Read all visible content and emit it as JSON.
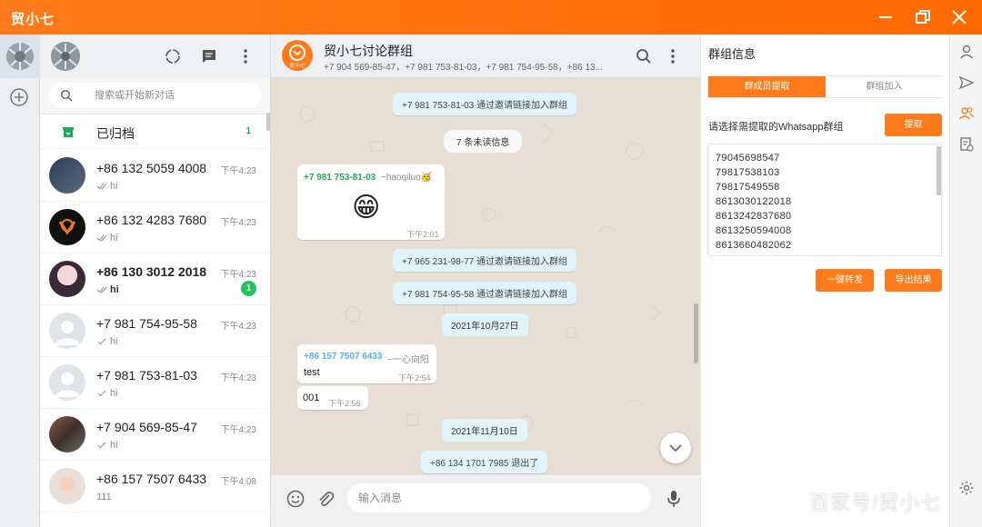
{
  "app": {
    "title": "贸小七"
  },
  "chat_list": {
    "search_placeholder": "搜索或开始新对话",
    "archived": {
      "label": "已归档",
      "count": "1"
    },
    "items": [
      {
        "name": "+86 132 5059 4008",
        "time": "下午4:23",
        "preview": "hi",
        "unread": ""
      },
      {
        "name": "+86 132 4283 7680",
        "time": "下午4:23",
        "preview": "hi",
        "unread": ""
      },
      {
        "name": "+86 130 3012 2018",
        "time": "下午4:23",
        "preview": "hi",
        "unread": "1"
      },
      {
        "name": "+7 981 754-95-58",
        "time": "下午4:23",
        "preview": "hi",
        "unread": ""
      },
      {
        "name": "+7 981 753-81-03",
        "time": "下午4:23",
        "preview": "hi",
        "unread": ""
      },
      {
        "name": "+7 904 569-85-47",
        "time": "下午4:23",
        "preview": "hi",
        "unread": ""
      },
      {
        "name": "+86 157 7507 6433",
        "time": "下午4:08",
        "preview": "111",
        "unread": ""
      }
    ]
  },
  "chat": {
    "logo_text": "贸小七",
    "title": "贸小七讨论群组",
    "members": "+7 904 569-85-47，+7 981 753-81-03，+7 981 754-95-58，+86 13...",
    "messages": {
      "sys_joined_1": "+7 981 753-81-03 通过邀请链接加入群组",
      "unread_marker": "7 条未读信息",
      "bubble1_sender": "+7 981 753-81-03",
      "bubble1_alias": "~haoqiluo🥳",
      "bubble1_emoji": "😁",
      "bubble1_time": "下午2:01",
      "sys_joined_2": "+7 965 231-98-77 通过邀请链接加入群组",
      "sys_joined_3": "+7 981 754-95-58 通过邀请链接加入群组",
      "date_1": "2021年10月27日",
      "bubble2_sender": "+86 157 7507 6433",
      "bubble2_alias": "~一心向阳",
      "bubble2_text": "test",
      "bubble2_time": "下午2:54",
      "bubble3_text": "001",
      "bubble3_time": "下午2:56",
      "date_2": "2021年11月10日",
      "sys_left": "+86 134 1701 7985 退出了"
    },
    "composer_placeholder": "输入消息"
  },
  "panel": {
    "title": "群组信息",
    "tab_extract": "群成员提取",
    "tab_join": "群组加入",
    "prompt": "请选择需提取的Whatsapp群组",
    "extract_button": "提取",
    "numbers": [
      "79045698547",
      "79817538103",
      "79817549558",
      "8613030122018",
      "8613242837680",
      "8613250594008",
      "8613660482062"
    ],
    "forward_button": "一键转发",
    "export_button": "导出结果"
  },
  "watermark": "百家号/贸小七",
  "colors": {
    "brand_orange": "#ff7a1a",
    "unread_green": "#25c15f",
    "system_msg_bg": "#e1f3fb",
    "chat_bg": "#e7ded4"
  },
  "icons": {
    "rail": [
      "account-avatar",
      "add-icon"
    ],
    "chat_list_header": [
      "status-icon",
      "chat-icon",
      "menu-dots-icon"
    ],
    "chat_header": [
      "search-icon",
      "menu-dots-icon"
    ],
    "composer": [
      "emoji-icon",
      "attach-icon",
      "mic-icon"
    ],
    "strip": [
      "user-icon",
      "send-icon",
      "group-icon",
      "report-icon",
      "settings-icon"
    ]
  }
}
